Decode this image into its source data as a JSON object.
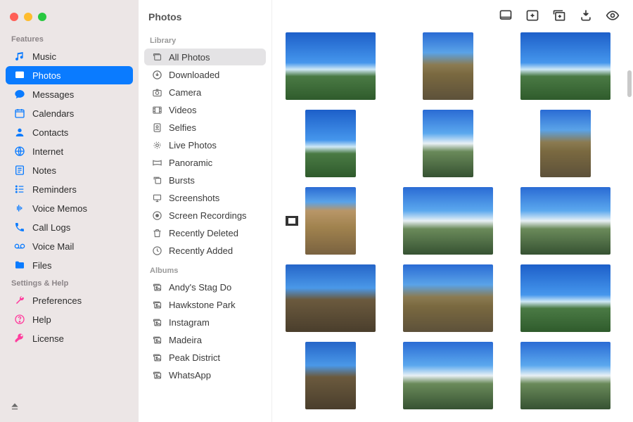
{
  "header": {
    "title": "Photos"
  },
  "sidebar": {
    "sections": [
      {
        "header": "Features",
        "items": [
          {
            "icon": "music-icon",
            "label": "Music"
          },
          {
            "icon": "photo-icon",
            "label": "Photos",
            "active": true
          },
          {
            "icon": "chat-icon",
            "label": "Messages"
          },
          {
            "icon": "calendar-icon",
            "label": "Calendars"
          },
          {
            "icon": "contact-icon",
            "label": "Contacts"
          },
          {
            "icon": "globe-icon",
            "label": "Internet"
          },
          {
            "icon": "note-icon",
            "label": "Notes"
          },
          {
            "icon": "list-icon",
            "label": "Reminders"
          },
          {
            "icon": "wave-icon",
            "label": "Voice Memos"
          },
          {
            "icon": "phone-icon",
            "label": "Call Logs"
          },
          {
            "icon": "voicemail-icon",
            "label": "Voice Mail"
          },
          {
            "icon": "folder-icon",
            "label": "Files"
          }
        ]
      },
      {
        "header": "Settings & Help",
        "items": [
          {
            "icon": "wrench-icon",
            "label": "Preferences"
          },
          {
            "icon": "help-icon",
            "label": "Help"
          },
          {
            "icon": "key-icon",
            "label": "License"
          }
        ]
      }
    ]
  },
  "library": {
    "section_label": "Library",
    "items": [
      {
        "icon": "stack-icon",
        "label": "All Photos",
        "selected": true
      },
      {
        "icon": "download-icon",
        "label": "Downloaded"
      },
      {
        "icon": "camera-icon",
        "label": "Camera"
      },
      {
        "icon": "film-icon",
        "label": "Videos"
      },
      {
        "icon": "selfie-icon",
        "label": "Selfies"
      },
      {
        "icon": "live-icon",
        "label": "Live Photos"
      },
      {
        "icon": "pano-icon",
        "label": "Panoramic"
      },
      {
        "icon": "burst-icon",
        "label": "Bursts"
      },
      {
        "icon": "screenshot-icon",
        "label": "Screenshots"
      },
      {
        "icon": "record-icon",
        "label": "Screen Recordings"
      },
      {
        "icon": "trash-icon",
        "label": "Recently Deleted"
      },
      {
        "icon": "clock-icon",
        "label": "Recently Added"
      }
    ],
    "albums_label": "Albums",
    "albums": [
      {
        "icon": "album-icon",
        "label": "Andy's Stag Do"
      },
      {
        "icon": "album-icon",
        "label": "Hawkstone Park"
      },
      {
        "icon": "album-icon",
        "label": "Instagram"
      },
      {
        "icon": "album-icon",
        "label": "Madeira"
      },
      {
        "icon": "album-icon",
        "label": "Peak District"
      },
      {
        "icon": "album-icon",
        "label": "WhatsApp"
      }
    ]
  },
  "toolbar": {
    "items": [
      {
        "name": "view-mode-button",
        "icon": "rect-bottom-icon"
      },
      {
        "name": "add-button",
        "icon": "plus-square-icon"
      },
      {
        "name": "add-to-album-button",
        "icon": "stack-plus-icon"
      },
      {
        "name": "download-button",
        "icon": "download-solid-icon"
      },
      {
        "name": "preview-button",
        "icon": "eye-icon"
      }
    ]
  },
  "grid": {
    "rows": [
      [
        {
          "o": "w",
          "s": "sky"
        },
        {
          "o": "p",
          "s": "path"
        },
        {
          "o": "w",
          "s": "sky"
        }
      ],
      [
        {
          "o": "p",
          "s": "sky"
        },
        {
          "o": "p",
          "s": "clouds"
        },
        {
          "o": "p",
          "s": "path"
        }
      ],
      [
        {
          "o": "p",
          "s": "rock",
          "video": true
        },
        {
          "o": "w",
          "s": "clouds"
        },
        {
          "o": "w",
          "s": "clouds"
        }
      ],
      [
        {
          "o": "w",
          "s": "ridge"
        },
        {
          "o": "w",
          "s": "path"
        },
        {
          "o": "w",
          "s": "sky"
        }
      ],
      [
        {
          "o": "p",
          "s": "ridge"
        },
        {
          "o": "w",
          "s": "clouds"
        },
        {
          "o": "w",
          "s": "clouds"
        }
      ]
    ]
  }
}
